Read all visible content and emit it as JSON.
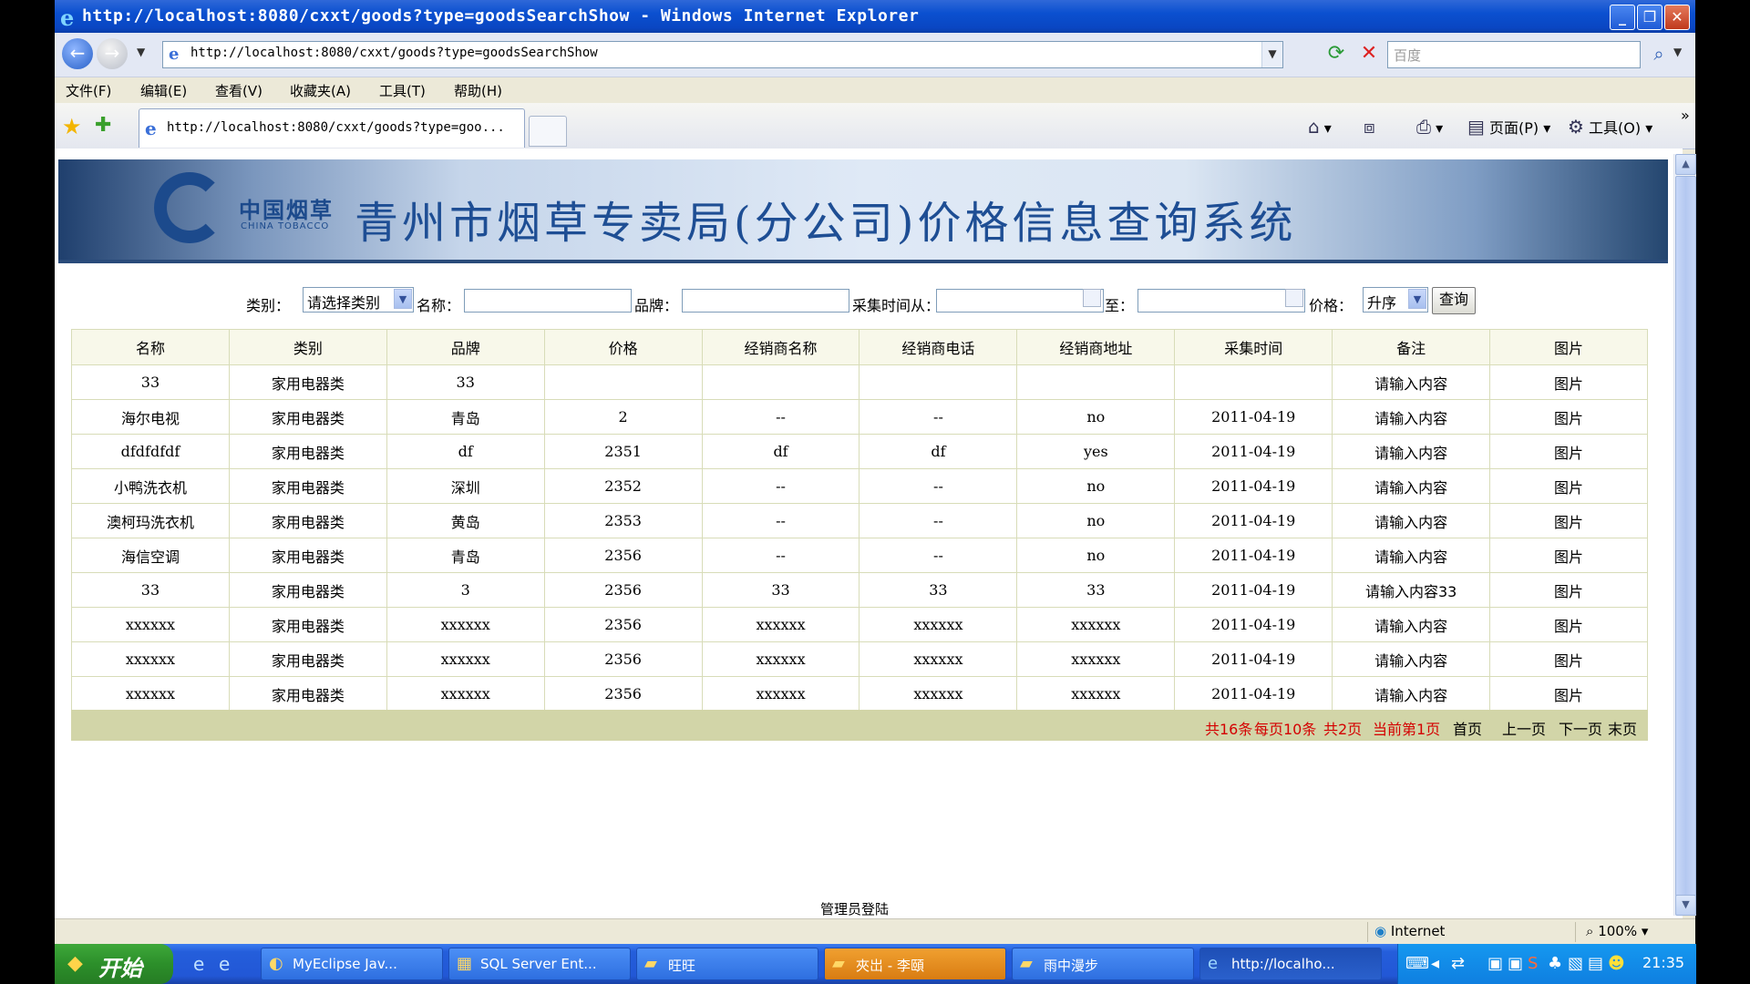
{
  "window": {
    "title": "http://localhost:8080/cxxt/goods?type=goodsSearchShow - Windows Internet Explorer",
    "minimize": "_",
    "restore": "❐",
    "close": "✕"
  },
  "address_bar": {
    "url": "http://localhost:8080/cxxt/goods?type=goodsSearchShow",
    "search_placeholder": "百度"
  },
  "menu": [
    "文件(F)",
    "编辑(E)",
    "查看(V)",
    "收藏夹(A)",
    "工具(T)",
    "帮助(H)"
  ],
  "tab": {
    "label": "http://localhost:8080/cxxt/goods?type=goo..."
  },
  "command_bar": {
    "page": "页面(P)",
    "tools": "工具(O)"
  },
  "banner": {
    "logo_cn": "中国烟草",
    "logo_en": "CHINA TOBACCO",
    "system_title": "青州市烟草专卖局(分公司)价格信息查询系统"
  },
  "search_form": {
    "category_label": "类别：",
    "category_value": "请选择类别",
    "name_label": "名称：",
    "brand_label": "品牌：",
    "time_from_label": "采集时间从：",
    "time_to_label": "至：",
    "price_label": "价格：",
    "price_order": "升序",
    "query_button": "查询"
  },
  "table": {
    "headers": [
      "名称",
      "类别",
      "品牌",
      "价格",
      "经销商名称",
      "经销商电话",
      "经销商地址",
      "采集时间",
      "备注",
      "图片"
    ],
    "rows": [
      [
        "33",
        "家用电器类",
        "33",
        "",
        "",
        "",
        "",
        "",
        "请输入内容",
        "图片"
      ],
      [
        "海尔电视",
        "家用电器类",
        "青岛",
        "2",
        "--",
        "--",
        "no",
        "2011-04-19",
        "请输入内容",
        "图片"
      ],
      [
        "dfdfdfdf",
        "家用电器类",
        "df",
        "2351",
        "df",
        "df",
        "yes",
        "2011-04-19",
        "请输入内容",
        "图片"
      ],
      [
        "小鸭洗衣机",
        "家用电器类",
        "深圳",
        "2352",
        "--",
        "--",
        "no",
        "2011-04-19",
        "请输入内容",
        "图片"
      ],
      [
        "澳柯玛洗衣机",
        "家用电器类",
        "黄岛",
        "2353",
        "--",
        "--",
        "no",
        "2011-04-19",
        "请输入内容",
        "图片"
      ],
      [
        "海信空调",
        "家用电器类",
        "青岛",
        "2356",
        "--",
        "--",
        "no",
        "2011-04-19",
        "请输入内容",
        "图片"
      ],
      [
        "33",
        "家用电器类",
        "3",
        "2356",
        "33",
        "33",
        "33",
        "2011-04-19",
        "请输入内容33",
        "图片"
      ],
      [
        "xxxxxx",
        "家用电器类",
        "xxxxxx",
        "2356",
        "xxxxxx",
        "xxxxxx",
        "xxxxxx",
        "2011-04-19",
        "请输入内容",
        "图片"
      ],
      [
        "xxxxxx",
        "家用电器类",
        "xxxxxx",
        "2356",
        "xxxxxx",
        "xxxxxx",
        "xxxxxx",
        "2011-04-19",
        "请输入内容",
        "图片"
      ],
      [
        "xxxxxx",
        "家用电器类",
        "xxxxxx",
        "2356",
        "xxxxxx",
        "xxxxxx",
        "xxxxxx",
        "2011-04-19",
        "请输入内容",
        "图片"
      ]
    ]
  },
  "pager": {
    "total": "共16条",
    "per_page": "每页10条",
    "pages": "共2页",
    "current": "当前第1页",
    "first": "首页",
    "prev": "上一页",
    "next": "下一页",
    "last": "末页"
  },
  "footer": {
    "admin_login": "管理员登陆"
  },
  "status_bar": {
    "zone": "Internet",
    "zoom": "100%"
  },
  "taskbar": {
    "start": "开始",
    "buttons": [
      "MyEclipse Jav...",
      "SQL Server Ent...",
      "旺旺",
      "夾岀 - 李頤",
      "雨中漫步",
      "http://localho..."
    ],
    "clock": "21:35"
  },
  "colors": {
    "xp_blue": "#0b50d0",
    "pager_bg": "#d2d5a8",
    "pager_red": "#d40000",
    "title_blue": "#1e4e94"
  }
}
